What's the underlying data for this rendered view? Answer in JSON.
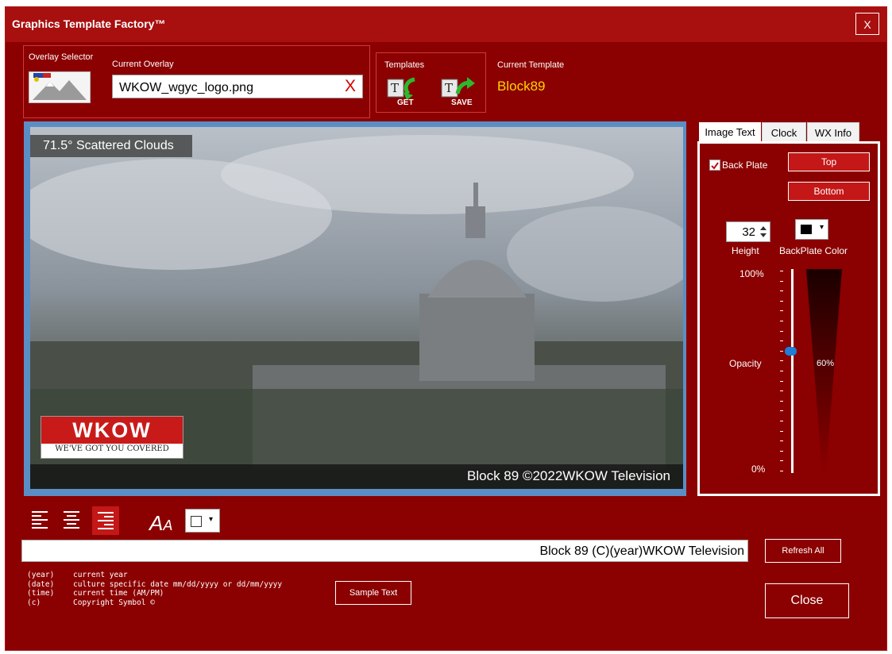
{
  "window": {
    "title": "Graphics Template Factory™",
    "close_label": "X"
  },
  "overlay": {
    "selector_label": "Overlay Selector",
    "current_label": "Current Overlay",
    "value": "WKOW_wgyc_logo.png",
    "clear_label": "X"
  },
  "templates": {
    "label": "Templates",
    "get_label": "GET",
    "save_label": "SAVE",
    "current_label": "Current Template",
    "current_value": "Block89"
  },
  "preview": {
    "top_text": "71.5° Scattered Clouds",
    "bottom_text": "Block 89 ©2022WKOW Television",
    "logo_title": "WKOW",
    "logo_tagline": "WE'VE GOT YOU COVERED"
  },
  "tabs": [
    {
      "label": "Image Text"
    },
    {
      "label": "Clock"
    },
    {
      "label": "WX Info"
    }
  ],
  "image_text": {
    "backplate_label": "Back Plate",
    "backplate_checked": true,
    "top_button": "Top",
    "bottom_button": "Bottom",
    "height_value": "32",
    "height_label": "Height",
    "color_label": "BackPlate Color",
    "backplate_color": "#000000",
    "opacity_max": "100%",
    "opacity_label": "Opacity",
    "opacity_min": "0%",
    "opacity_value": "60%"
  },
  "text_toolbar": {
    "text_color": "#ffffff"
  },
  "text_field": {
    "value": "Block 89 (C)(year)WKOW Television"
  },
  "buttons": {
    "refresh": "Refresh All",
    "sample": "Sample Text",
    "close": "Close"
  },
  "help": [
    {
      "token": "(year)",
      "desc": "current year"
    },
    {
      "token": "(date)",
      "desc": "culture specific date mm/dd/yyyy or dd/mm/yyyy"
    },
    {
      "token": "(time)",
      "desc": "current time (AM/PM)"
    },
    {
      "token": "(c)",
      "desc": "Copyright Symbol ©"
    }
  ],
  "colors": {
    "window_bg": "#8b0000",
    "titlebar": "#a80f0f",
    "accent_button": "#c41717",
    "template_name": "#ffd400"
  }
}
